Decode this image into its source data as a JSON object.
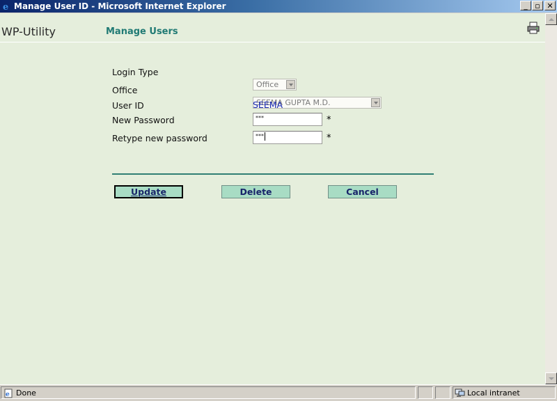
{
  "window": {
    "title": "Manage User ID - Microsoft Internet Explorer",
    "minimize": "_",
    "maximize": "▫",
    "close": "✕"
  },
  "header": {
    "brand": "WP-Utility",
    "page_title": "Manage Users",
    "icons": {
      "browser": "ie-icon",
      "print": "printer-icon"
    }
  },
  "form": {
    "login_type": {
      "label": "Login Type",
      "value": "Office"
    },
    "office": {
      "label": "Office",
      "value": "SEEMA GUPTA M.D."
    },
    "user_id": {
      "label": "User ID",
      "value": "SEEMA"
    },
    "new_password": {
      "label": "New Password",
      "value": "***",
      "required_mark": "*"
    },
    "retype_password": {
      "label": "Retype new password",
      "value": "***",
      "required_mark": "*"
    }
  },
  "buttons": {
    "update": "Update",
    "delete": "Delete",
    "cancel": "Cancel"
  },
  "statusbar": {
    "status": "Done",
    "zone": "Local intranet"
  },
  "colors": {
    "page_background": "#e5eedc",
    "heading": "#207a74",
    "divider": "#2f7f73",
    "button_fill": "#a8dcc4",
    "button_text": "#18246a",
    "user_id_value": "#1a2ab3"
  }
}
